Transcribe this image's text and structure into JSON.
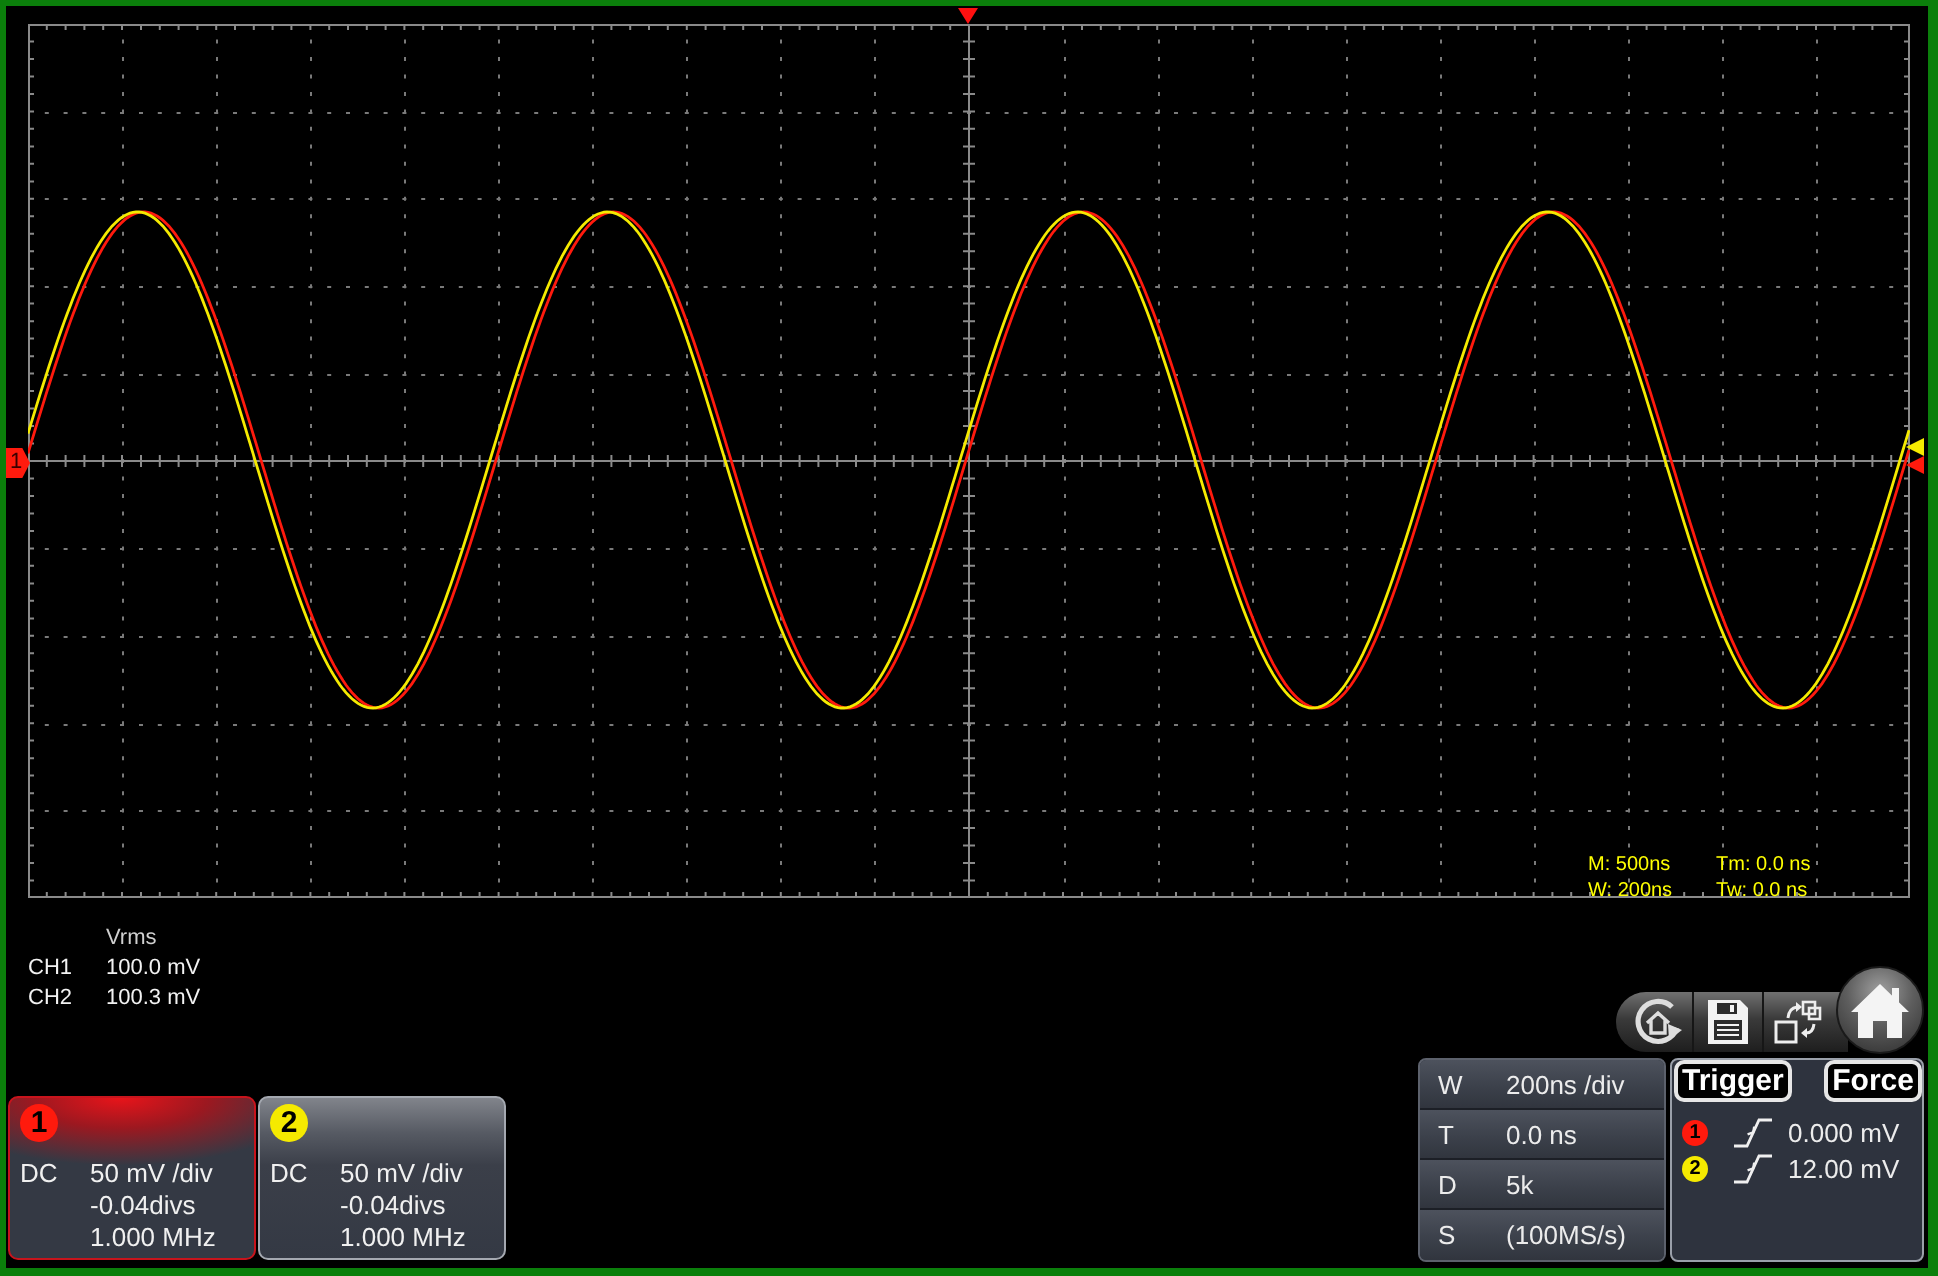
{
  "channel_marker": {
    "label": "1"
  },
  "timebase_overlay": [
    "M: 500ns",
    "Tm: 0.0 ns",
    "W: 200ns",
    "Tw: 0.0 ns"
  ],
  "readings": {
    "header": "Vrms",
    "rows": [
      {
        "channel": "CH1",
        "value": "100.0 mV"
      },
      {
        "channel": "CH2",
        "value": "100.3 mV"
      }
    ]
  },
  "channels": [
    {
      "number": "1",
      "color": "#ff1a0d",
      "selected": true,
      "coupling": "DC",
      "scale": "50 mV /div",
      "offset": "-0.04divs",
      "bandwidth": "1.000 MHz"
    },
    {
      "number": "2",
      "color": "#f5ea00",
      "selected": false,
      "coupling": "DC",
      "scale": "50 mV /div",
      "offset": "-0.04divs",
      "bandwidth": "1.000 MHz"
    }
  ],
  "timebase": [
    {
      "key": "W",
      "value": "200ns /div"
    },
    {
      "key": "T",
      "value": "0.0 ns"
    },
    {
      "key": "D",
      "value": "5k"
    },
    {
      "key": "S",
      "value": "(100MS/s)"
    }
  ],
  "trigger": {
    "buttons": [
      "Trigger",
      "Force"
    ],
    "sources": [
      {
        "number": "1",
        "color": "#ff1a0d",
        "value": "0.000 mV"
      },
      {
        "number": "2",
        "color": "#f5ea00",
        "value": "12.00 mV"
      }
    ]
  }
}
